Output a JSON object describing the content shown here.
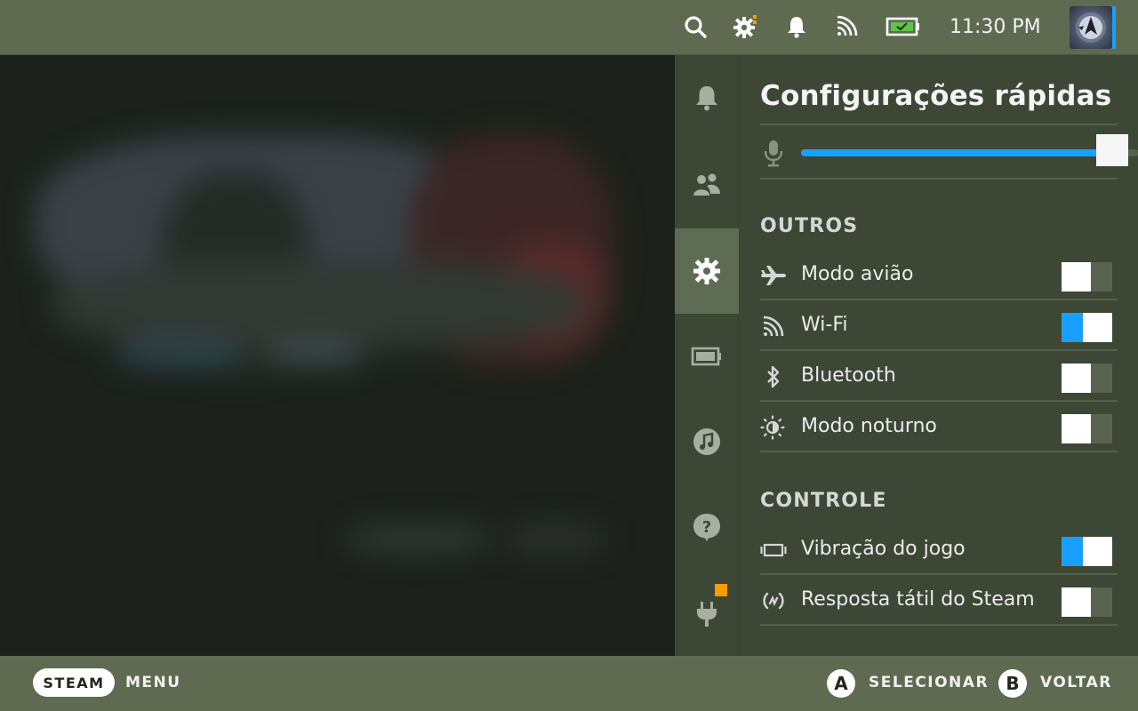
{
  "topbar": {
    "clock": "11:30 PM",
    "icons": [
      "search-icon",
      "settings-icon",
      "bell-icon",
      "wifi-icon",
      "battery-icon"
    ],
    "accent_color": "#1a9fff"
  },
  "sidenav": {
    "items": [
      {
        "name": "notifications",
        "icon": "bell-icon"
      },
      {
        "name": "friends",
        "icon": "friends-icon"
      },
      {
        "name": "quick-settings",
        "icon": "gear-icon",
        "active": true
      },
      {
        "name": "performance",
        "icon": "battery-icon"
      },
      {
        "name": "music",
        "icon": "music-icon"
      },
      {
        "name": "help",
        "icon": "help-icon"
      },
      {
        "name": "plugins",
        "icon": "plug-icon",
        "badge": true
      }
    ],
    "badge_color": "#ff9a00"
  },
  "panel": {
    "title": "Configurações rápidas",
    "microphone_level": 0.92,
    "sections": [
      {
        "label": "OUTROS",
        "items": [
          {
            "label": "Modo avião",
            "icon": "airplane-icon",
            "on": false
          },
          {
            "label": "Wi-Fi",
            "icon": "wifi-icon",
            "on": true
          },
          {
            "label": "Bluetooth",
            "icon": "bluetooth-icon",
            "on": false
          },
          {
            "label": "Modo noturno",
            "icon": "night-mode-icon",
            "on": false
          }
        ]
      },
      {
        "label": "CONTROLE",
        "items": [
          {
            "label": "Vibração do jogo",
            "icon": "rumble-icon",
            "on": true
          },
          {
            "label": "Resposta tátil do Steam",
            "icon": "haptics-icon",
            "on": false
          }
        ]
      }
    ]
  },
  "bottombar": {
    "steam_label": "STEAM",
    "menu_label": "MENU",
    "a_glyph": "A",
    "select_label": "SELECIONAR",
    "b_glyph": "B",
    "back_label": "VOLTAR"
  }
}
